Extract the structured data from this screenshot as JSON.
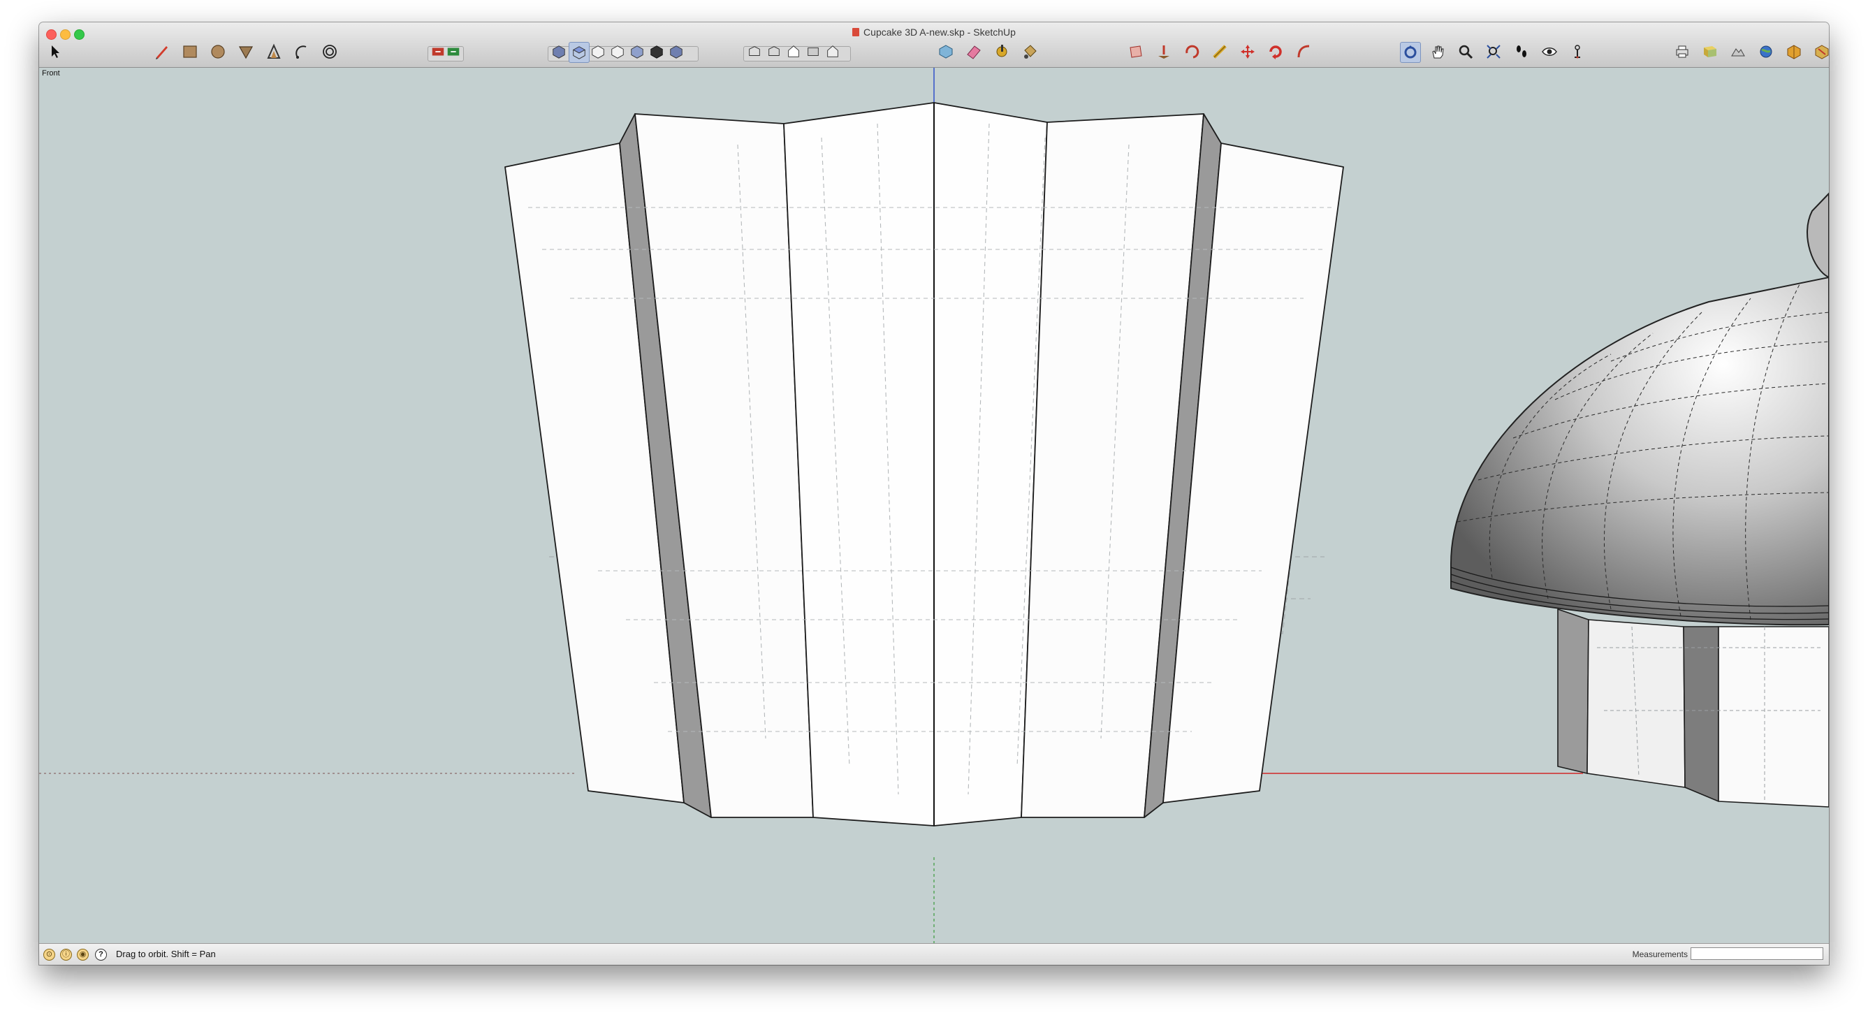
{
  "window": {
    "title": "Cupcake 3D A-new.skp - SketchUp"
  },
  "toolbar": {
    "tools": [
      {
        "name": "select-tool",
        "icon": "arrow-cursor-icon"
      },
      {
        "name": "line-tool",
        "icon": "pencil-icon"
      },
      {
        "name": "rectangle-tool",
        "icon": "rectangle-icon"
      },
      {
        "name": "circle-tool",
        "icon": "circle-icon"
      },
      {
        "name": "push-pull-tool",
        "icon": "push-pull-icon"
      },
      {
        "name": "tape-measure-tool",
        "icon": "tape-measure-icon"
      },
      {
        "name": "arc-tool",
        "icon": "arc-icon"
      },
      {
        "name": "offset-tool",
        "icon": "offset-icon"
      },
      {
        "name": "views-group",
        "icon": "view-cubes-icon"
      },
      {
        "name": "styles-group",
        "icon": "styles-icon"
      },
      {
        "name": "components-tool",
        "icon": "component-icon"
      },
      {
        "name": "eraser-tool",
        "icon": "eraser-icon"
      },
      {
        "name": "paint-bucket-tool",
        "icon": "paint-bucket-icon"
      },
      {
        "name": "follow-me-tool",
        "icon": "follow-me-icon"
      },
      {
        "name": "move-tool",
        "icon": "move-icon"
      },
      {
        "name": "rotate-tool",
        "icon": "rotate-icon"
      },
      {
        "name": "orbit-tool",
        "icon": "orbit-icon"
      },
      {
        "name": "pan-tool",
        "icon": "hand-icon"
      },
      {
        "name": "zoom-tool",
        "icon": "magnifier-icon"
      },
      {
        "name": "zoom-extents-tool",
        "icon": "zoom-extents-icon"
      },
      {
        "name": "walk-tool",
        "icon": "footprints-icon"
      },
      {
        "name": "look-around-tool",
        "icon": "eye-icon"
      },
      {
        "name": "position-camera-tool",
        "icon": "camera-position-icon"
      },
      {
        "name": "print-tool",
        "icon": "printer-icon"
      },
      {
        "name": "extension-tools",
        "icon": "extension-icons"
      }
    ]
  },
  "viewport": {
    "scene_label": "Front",
    "background": "#c4d0d0",
    "axis_colors": {
      "red": "#d04040",
      "green": "#3a9a3a",
      "blue": "#3050c8"
    }
  },
  "statusbar": {
    "hint": "Drag to orbit.  Shift = Pan",
    "measurements_label": "Measurements",
    "measurements_value": "",
    "icons": [
      "geo-location-icon",
      "credits-icon",
      "user-icon",
      "help-icon"
    ]
  }
}
